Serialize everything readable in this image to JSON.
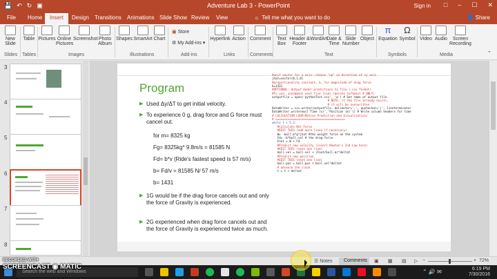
{
  "colors": {
    "accent": "#b7472a",
    "slide_title": "#4ea72e",
    "code_red": "#d0312d",
    "selected_border": "#d24726"
  },
  "titlebar": {
    "title": "Adventure Lab 3 - PowerPoint",
    "signin": "Sign in",
    "qat_icons": [
      "save-icon",
      "undo-icon",
      "redo-icon",
      "start-from-beginning-icon"
    ],
    "window_icons": [
      "ribbon-display-icon",
      "minimize-icon",
      "maximize-icon",
      "close-icon"
    ]
  },
  "tabs": [
    {
      "label": "File"
    },
    {
      "label": "Home"
    },
    {
      "label": "Insert"
    },
    {
      "label": "Design"
    },
    {
      "label": "Transitions"
    },
    {
      "label": "Animations"
    },
    {
      "label": "Slide Show"
    },
    {
      "label": "Review"
    },
    {
      "label": "View"
    }
  ],
  "tell_me": "Tell me what you want to do",
  "share": "Share",
  "ribbon": {
    "groups": [
      "Slides",
      "Tables",
      "Images",
      "Illustrations",
      "Add-ins",
      "Links",
      "Comments",
      "Text",
      "Symbols",
      "Media"
    ],
    "buttons": {
      "new_slide": "New Slide",
      "table": "Table",
      "pictures": "Pictures",
      "online_pictures": "Online Pictures",
      "screenshot": "Screenshot",
      "photo_album": "Photo Album",
      "shapes": "Shapes",
      "smartart": "SmartArt",
      "chart": "Chart",
      "store": "Store",
      "my_addins": "My Add-ins",
      "hyperlink": "Hyperlink",
      "action": "Action",
      "comment": "Comment",
      "text_box": "Text Box",
      "header_footer": "Header & Footer",
      "wordart": "WordArt",
      "date_time": "Date & Time",
      "slide_number": "Slide Number",
      "object": "Object",
      "equation": "Equation",
      "symbol": "Symbol",
      "video": "Video",
      "audio": "Audio",
      "screen_recording": "Screen Recording"
    }
  },
  "thumbnails": [
    {
      "num": "3"
    },
    {
      "num": "4"
    },
    {
      "num": "5"
    },
    {
      "num": "6"
    },
    {
      "num": "7"
    },
    {
      "num": "8"
    }
  ],
  "slide": {
    "title": "Program",
    "bullets": [
      "Used Δy/ΔT to get initial velocity.",
      "To experience 0 g, drag force and G force must cancel out.",
      "1G would be if the drag force cancels out and only the force of Gravity is experienced.",
      "2G experienced when drag force cancels out and the force of Gravity is experienced twice as much."
    ],
    "sublines": [
      "for m= 8325 kg",
      "Fg= 8325kg* 9.8m/s = 81585 N",
      "Fd= b*v    (Ride's fastest speed is 57 m/s)",
      "b= Fd/v = 81585 N/ 57 m/s",
      "b= 1431"
    ],
    "code_lines": [
      {
        "t": "#unit vector for y axis--choose \"up\" as direction of +y axis",
        "c": "red"
      },
      {
        "t": "jhat=vector(0,1,0)",
        "c": "blk"
      },
      {
        "t": "",
        "c": "blk"
      },
      {
        "t": "#proportionality constant, b, for magnitude of drag force",
        "c": "red"
      },
      {
        "t": "b=1431",
        "c": "blk"
      },
      {
        "t": "",
        "c": "blk"
      },
      {
        "t": "#OPTIONAL: Output model predictions to file (.csv format)",
        "c": "red"
      },
      {
        "t": "#To use, uncomment next five lines (delete leftmost # ONLY)",
        "c": "red"
      },
      {
        "t": "outputfile = open('pythonTest.csv', 'w') # Set name of output file",
        "c": "blk"
      },
      {
        "t": "                                # NOTE: if the file already exists,",
        "c": "red"
      },
      {
        "t": "                                # it will be overwritten",
        "c": "red"
      },
      {
        "t": "DataWriter = csv.writer(outputfile, delimiter=',', quotechar='|', lineterminator",
        "c": "blk"
      },
      {
        "t": "DataWriter.writerow(['Time (s)','Position (m)']) # Write column headers for time",
        "c": "blk"
      },
      {
        "t": "",
        "c": "blk"
      },
      {
        "t": "# CALCULATION LOOP(Motion Prediction and Visualization)",
        "c": "red"
      },
      {
        "t": "# ========================================",
        "c": "red"
      },
      {
        "t": "while t < 5.2:",
        "c": "blu"
      },
      {
        "t": "   #Calculate Net Force",
        "c": "red"
      },
      {
        "t": "   #EDIT THIS (add more lines if necessary)",
        "c": "red"
      },
      {
        "t": "   W= -ball.m*g*jhat #the weight force on the system",
        "c": "blk"
      },
      {
        "t": "   Fd= -b*ball.vel # the drag force",
        "c": "blk"
      },
      {
        "t": "   Fnet = W + Fd",
        "c": "blk"
      },
      {
        "t": "",
        "c": "blk"
      },
      {
        "t": "   #Predict new velocity (insert Newton's 2nd Law here)",
        "c": "red"
      },
      {
        "t": "   #EDIT THIS (next one line)",
        "c": "red"
      },
      {
        "t": "   ball.vel = ball.vel + (Fnet/ball.m)*deltat",
        "c": "blk"
      },
      {
        "t": "   #Predict new position",
        "c": "red"
      },
      {
        "t": "   #EDIT THIS (next one line)",
        "c": "red"
      },
      {
        "t": "   ball.pos = ball.pos + ball.vel*deltat",
        "c": "blk"
      },
      {
        "t": "   # advance the clock",
        "c": "red"
      },
      {
        "t": "   t = t + deltat",
        "c": "blk"
      }
    ]
  },
  "statusbar": {
    "notes": "Notes",
    "comments": "Comments",
    "zoom": "72%"
  },
  "taskbar": {
    "search_placeholder": "Search the web and Windows",
    "time": "6:19 PM",
    "date": "7/30/2016"
  },
  "watermark": {
    "recorded_with": "RECORDED WITH",
    "brand": "SCREENCAST ◉ MATIC"
  }
}
